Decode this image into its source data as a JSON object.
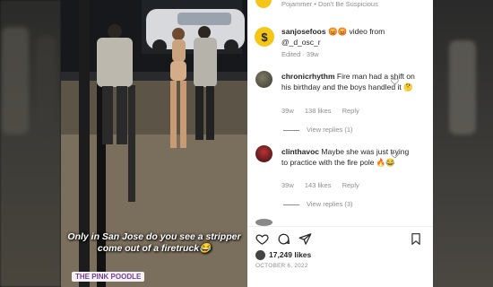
{
  "top_bar": {
    "text": "Pojammer • Don't Be Suspicious"
  },
  "post": {
    "username": "sanjosefoos",
    "emojis": "😡😡",
    "text": " video from",
    "mention": "@_d_osc_r",
    "meta": "Edited · 39w"
  },
  "comments": [
    {
      "username": "chronicrhythm",
      "text": "Fire man had a shift on his birthday and the boys handled it 🤔",
      "age": "39w",
      "likes": "138 likes",
      "reply": "Reply",
      "view_replies": "View replies (1)"
    },
    {
      "username": "clinthavoc",
      "text": "Maybe she was just trying to practice with the fire pole 🔥😂",
      "age": "39w",
      "likes": "143 likes",
      "reply": "Reply",
      "view_replies": "View replies (3)"
    }
  ],
  "likes_count": "17,249 likes",
  "date": "OCTOBER 6, 2022",
  "video": {
    "caption": "Only in San Jose do you see a stripper come out of a firetruck😂",
    "watermark": "THE PINK POODLE"
  },
  "icons": [
    "heart-icon",
    "comment-icon",
    "share-icon",
    "bookmark-icon"
  ],
  "colors": {
    "accent": "#f5c518",
    "text": "#262626",
    "muted": "#8e8e8e"
  }
}
